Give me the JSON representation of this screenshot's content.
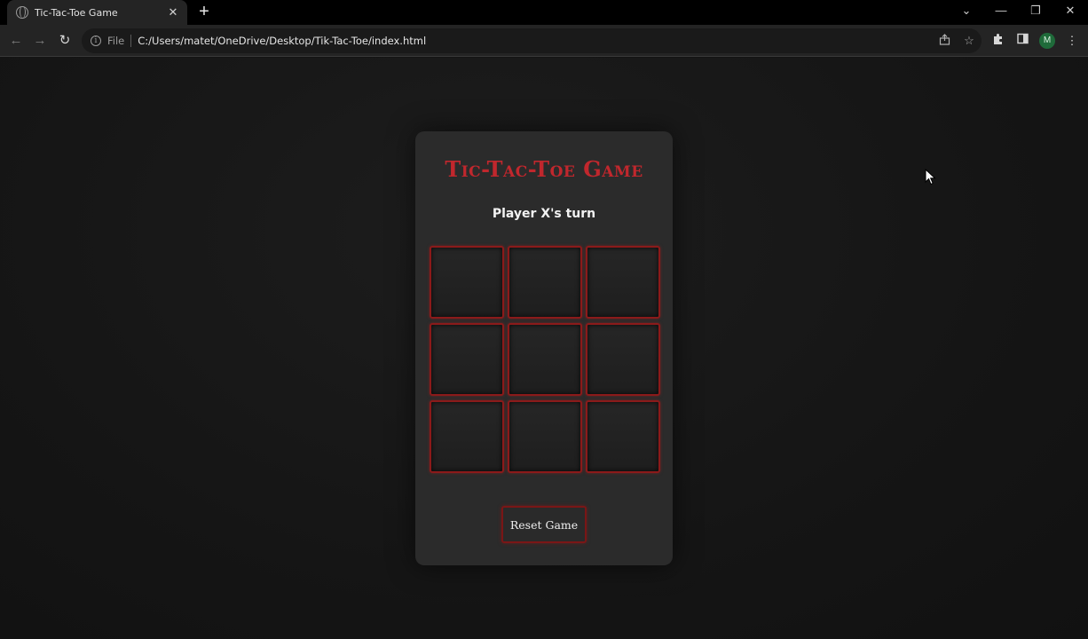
{
  "browser": {
    "tab_title": "Tic-Tac-Toe Game",
    "tab_close": "✕",
    "new_tab": "+",
    "url_scheme": "File",
    "url": "C:/Users/matet/OneDrive/Desktop/Tik-Tac-Toe/index.html",
    "profile_initial": "M",
    "window_controls": {
      "tab_search": "⌄",
      "minimize": "—",
      "restore": "❐",
      "close": "✕"
    },
    "nav": {
      "back": "←",
      "forward": "→",
      "reload": "↻"
    },
    "icons": [
      "share-icon",
      "bookmark-star-icon",
      "extensions-icon",
      "side-panel-icon",
      "menu-icon"
    ]
  },
  "game": {
    "title": "Tic-Tac-Toe Game",
    "status": "Player X's turn",
    "cells": [
      "",
      "",
      "",
      "",
      "",
      "",
      "",
      "",
      ""
    ],
    "reset_label": "Reset Game"
  },
  "colors": {
    "accent": "#c1272d",
    "card_background": "#2b2b2b",
    "page_background": "#141414"
  }
}
